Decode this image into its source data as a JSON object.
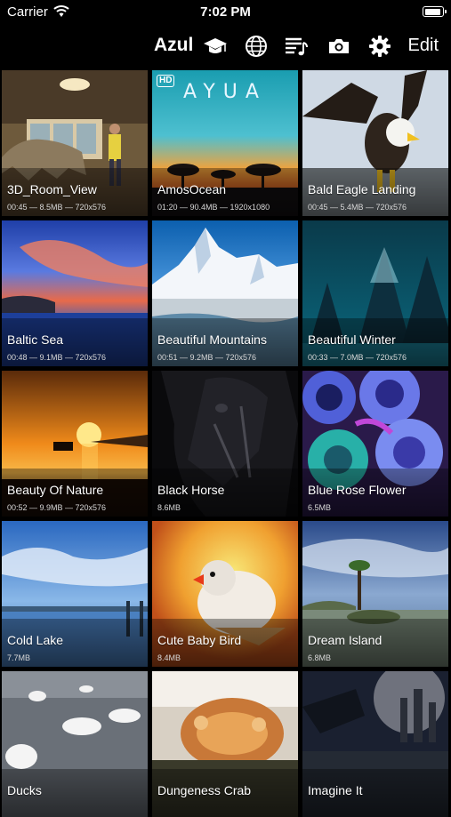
{
  "status_bar": {
    "carrier": "Carrier",
    "time": "7:02 PM",
    "wifi_icon": "wifi-icon",
    "battery_icon": "battery-icon"
  },
  "toolbar": {
    "title": "Azul",
    "edit_label": "Edit",
    "icons": [
      "graduation-cap-icon",
      "globe-icon",
      "playlist-icon",
      "camera-icon",
      "gear-icon"
    ]
  },
  "videos": [
    {
      "name": "3D_Room_View",
      "meta": "00:45 — 8.5MB — 720x576"
    },
    {
      "name": "AmosOcean",
      "meta": "01:20 — 90.4MB — 1920x1080",
      "badge": "HD",
      "banner": "AYUA"
    },
    {
      "name": "Bald Eagle Landing",
      "meta": "00:45 — 5.4MB — 720x576"
    },
    {
      "name": "Baltic Sea",
      "meta": "00:48 — 9.1MB — 720x576"
    },
    {
      "name": "Beautiful Mountains",
      "meta": "00:51 — 9.2MB — 720x576"
    },
    {
      "name": "Beautiful Winter",
      "meta": "00:33 — 7.0MB — 720x576"
    },
    {
      "name": "Beauty Of Nature",
      "meta": "00:52 — 9.9MB — 720x576"
    },
    {
      "name": "Black Horse",
      "meta": "8.6MB"
    },
    {
      "name": "Blue Rose Flower",
      "meta": "6.5MB"
    },
    {
      "name": "Cold Lake",
      "meta": "7.7MB"
    },
    {
      "name": "Cute Baby Bird",
      "meta": "8.4MB"
    },
    {
      "name": "Dream Island",
      "meta": "6.8MB"
    },
    {
      "name": "Ducks",
      "meta": ""
    },
    {
      "name": "Dungeness Crab",
      "meta": ""
    },
    {
      "name": "Imagine It",
      "meta": ""
    }
  ]
}
